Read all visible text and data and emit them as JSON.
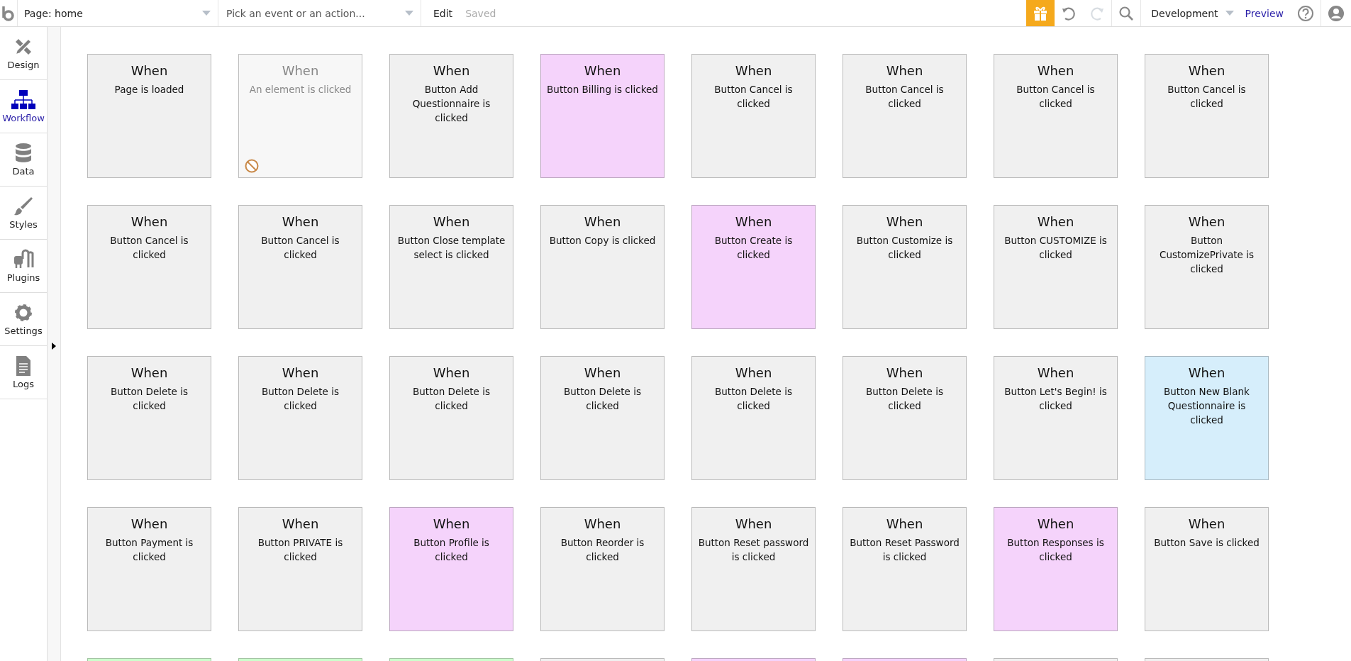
{
  "topbar": {
    "page_select": "Page: home",
    "event_select": {
      "placeholder": "Pick an event or an action..."
    },
    "edit": "Edit",
    "saved": "Saved",
    "environment": "Development",
    "preview": "Preview"
  },
  "sidebar": {
    "items": [
      {
        "label": "Design",
        "selected": false
      },
      {
        "label": "Workflow",
        "selected": true
      },
      {
        "label": "Data",
        "selected": false
      },
      {
        "label": "Styles",
        "selected": false
      },
      {
        "label": "Plugins",
        "selected": false
      },
      {
        "label": "Settings",
        "selected": false
      },
      {
        "label": "Logs",
        "selected": false
      }
    ]
  },
  "cards": [
    {
      "title": "When",
      "event": "Page is loaded",
      "color": "#f0f0f0",
      "disabled": false
    },
    {
      "title": "When",
      "event": "An element is clicked",
      "color": "#f7f7f7",
      "disabled": true
    },
    {
      "title": "When",
      "event": "Button Add Questionnaire is clicked",
      "color": "#f0f0f0",
      "disabled": false
    },
    {
      "title": "When",
      "event": "Button Billing is clicked",
      "color": "#f5d3fb",
      "disabled": false
    },
    {
      "title": "When",
      "event": "Button Cancel is clicked",
      "color": "#f0f0f0",
      "disabled": false
    },
    {
      "title": "When",
      "event": "Button Cancel is clicked",
      "color": "#f0f0f0",
      "disabled": false
    },
    {
      "title": "When",
      "event": "Button Cancel is clicked",
      "color": "#f0f0f0",
      "disabled": false
    },
    {
      "title": "When",
      "event": "Button Cancel is clicked",
      "color": "#f0f0f0",
      "disabled": false
    },
    {
      "title": "When",
      "event": "Button Cancel is clicked",
      "color": "#f0f0f0",
      "disabled": false
    },
    {
      "title": "When",
      "event": "Button Cancel is clicked",
      "color": "#f0f0f0",
      "disabled": false
    },
    {
      "title": "When",
      "event": "Button Close template select is clicked",
      "color": "#f0f0f0",
      "disabled": false
    },
    {
      "title": "When",
      "event": "Button Copy is clicked",
      "color": "#f0f0f0",
      "disabled": false
    },
    {
      "title": "When",
      "event": "Button Create is clicked",
      "color": "#f5d3fb",
      "disabled": false
    },
    {
      "title": "When",
      "event": "Button Customize is clicked",
      "color": "#f0f0f0",
      "disabled": false
    },
    {
      "title": "When",
      "event": "Button CUSTOMIZE is clicked",
      "color": "#f0f0f0",
      "disabled": false
    },
    {
      "title": "When",
      "event": "Button CustomizePrivate is clicked",
      "color": "#f0f0f0",
      "disabled": false
    },
    {
      "title": "When",
      "event": "Button Delete is clicked",
      "color": "#f0f0f0",
      "disabled": false
    },
    {
      "title": "When",
      "event": "Button Delete is clicked",
      "color": "#f0f0f0",
      "disabled": false
    },
    {
      "title": "When",
      "event": "Button Delete is clicked",
      "color": "#f0f0f0",
      "disabled": false
    },
    {
      "title": "When",
      "event": "Button Delete is clicked",
      "color": "#f0f0f0",
      "disabled": false
    },
    {
      "title": "When",
      "event": "Button Delete is clicked",
      "color": "#f0f0f0",
      "disabled": false
    },
    {
      "title": "When",
      "event": "Button Delete is clicked",
      "color": "#f0f0f0",
      "disabled": false
    },
    {
      "title": "When",
      "event": "Button Let's Begin! is clicked",
      "color": "#f0f0f0",
      "disabled": false
    },
    {
      "title": "When",
      "event": "Button New Blank Questionnaire is clicked",
      "color": "#d6eefb",
      "disabled": false
    },
    {
      "title": "When",
      "event": "Button Payment is clicked",
      "color": "#f0f0f0",
      "disabled": false
    },
    {
      "title": "When",
      "event": "Button PRIVATE is clicked",
      "color": "#f0f0f0",
      "disabled": false
    },
    {
      "title": "When",
      "event": "Button Profile is clicked",
      "color": "#f5d3fb",
      "disabled": false
    },
    {
      "title": "When",
      "event": "Button Reorder is clicked",
      "color": "#f0f0f0",
      "disabled": false
    },
    {
      "title": "When",
      "event": "Button Reset password is clicked",
      "color": "#f0f0f0",
      "disabled": false
    },
    {
      "title": "When",
      "event": "Button Reset Password is clicked",
      "color": "#f0f0f0",
      "disabled": false
    },
    {
      "title": "When",
      "event": "Button Responses is clicked",
      "color": "#f5d3fb",
      "disabled": false
    },
    {
      "title": "When",
      "event": "Button Save is clicked",
      "color": "#f0f0f0",
      "disabled": false
    },
    {
      "color": "#ccffcc"
    },
    {
      "color": "#ccffcc"
    },
    {
      "color": "#ccffcc"
    },
    {
      "color": "#f0f0f0"
    },
    {
      "color": "#f5d3fb"
    },
    {
      "color": "#f5d3fb"
    },
    {
      "color": "#f0f0f0"
    },
    {
      "color": "#f0f0f0"
    }
  ]
}
